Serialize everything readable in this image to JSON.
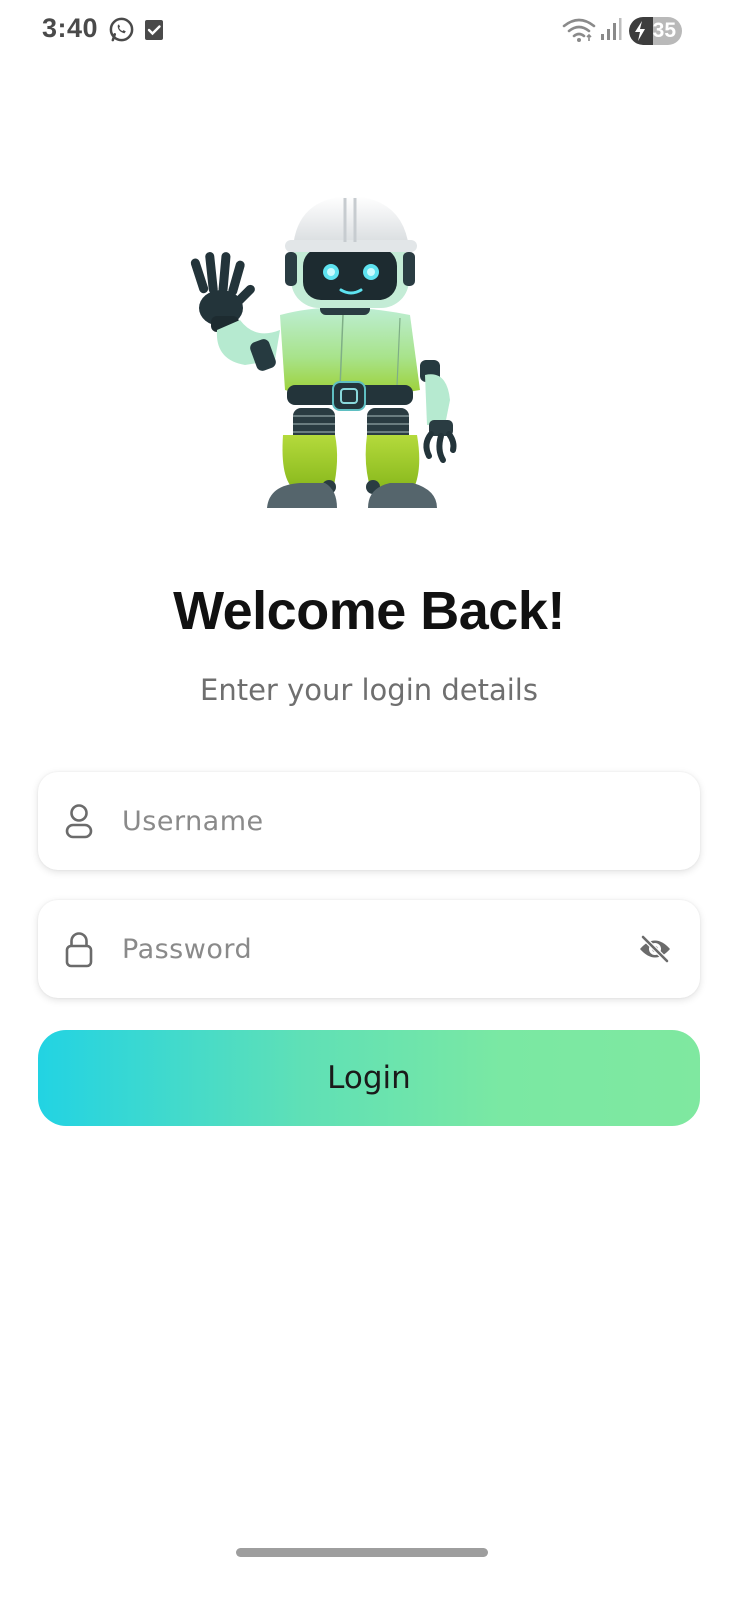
{
  "status_bar": {
    "time": "3:40",
    "battery_level": "35",
    "icons": [
      "whatsapp-icon",
      "checkbox-notification-icon",
      "wifi-icon",
      "signal-icon",
      "battery-charging-icon"
    ]
  },
  "illustration": {
    "icon": "waving-robot-illustration"
  },
  "welcome": {
    "title": "Welcome Back!",
    "subtitle": "Enter your login details"
  },
  "form": {
    "username": {
      "value": "",
      "placeholder": "Username",
      "icon": "user-icon"
    },
    "password": {
      "value": "",
      "placeholder": "Password",
      "icon": "lock-icon",
      "toggle_icon": "eye-off-icon"
    },
    "login_label": "Login"
  },
  "colors": {
    "button_gradient_start": "#22d3e3",
    "button_gradient_end": "#7fe8a0",
    "title": "#111111",
    "subtitle": "#6f6f6f"
  }
}
